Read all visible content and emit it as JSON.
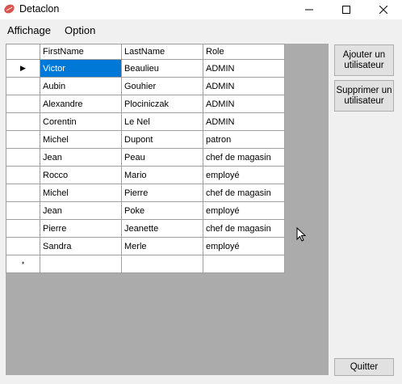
{
  "window": {
    "title": "Detaclon"
  },
  "menu": {
    "items": [
      "Affichage",
      "Option"
    ]
  },
  "grid": {
    "columns": [
      "FirstName",
      "LastName",
      "Role"
    ],
    "rows": [
      [
        "Victor",
        "Beaulieu",
        "ADMIN"
      ],
      [
        "Aubin",
        "Gouhier",
        "ADMIN"
      ],
      [
        "Alexandre",
        "Plociniczak",
        "ADMIN"
      ],
      [
        "Corentin",
        "Le Nel",
        "ADMIN"
      ],
      [
        "Michel",
        "Dupont",
        "patron"
      ],
      [
        "Jean",
        "Peau",
        "chef de magasin"
      ],
      [
        "Rocco",
        "Mario",
        "employé"
      ],
      [
        "Michel",
        "Pierre",
        "chef de magasin"
      ],
      [
        "Jean",
        "Poke",
        "employé"
      ],
      [
        "Pierre",
        "Jeanette",
        "chef de magasin"
      ],
      [
        "Sandra",
        "Merle",
        "employé"
      ]
    ],
    "current_row_marker": "▶",
    "new_row_marker": "*"
  },
  "buttons": {
    "add_user": "Ajouter un utilisateur",
    "remove_user": "Supprimer un utilisateur",
    "quit": "Quitter"
  },
  "colors": {
    "selection": "#0078d7",
    "grid_background": "#ababab"
  }
}
